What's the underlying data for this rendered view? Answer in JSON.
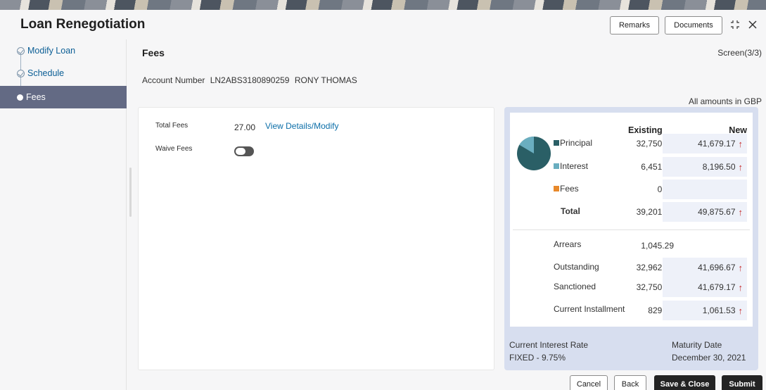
{
  "header": {
    "title": "Loan Renegotiation",
    "remarks_label": "Remarks",
    "documents_label": "Documents",
    "minimize_icon": "minimize-icon",
    "close_icon": "close-icon"
  },
  "sidebar": {
    "steps": [
      {
        "label": "Modify Loan",
        "state": "done"
      },
      {
        "label": "Schedule",
        "state": "done"
      },
      {
        "label": "Fees",
        "state": "active"
      }
    ]
  },
  "main": {
    "title": "Fees",
    "screen_indicator": "Screen(3/3)",
    "account_label": "Account Number",
    "account_number": "LN2ABS3180890259",
    "customer_name": "RONY THOMAS",
    "amounts_note": "All amounts in GBP"
  },
  "fees": {
    "total_fees_label": "Total Fees",
    "total_fees_value": "27.00",
    "view_link": "View Details/Modify",
    "waive_fees_label": "Waive Fees",
    "waive_fees_on": false
  },
  "summary": {
    "col_existing": "Existing",
    "col_new": "New",
    "colors": {
      "principal": "#2a5f66",
      "interest": "#6aaec0",
      "fees": "#e8892b",
      "increase_arrow": "#c62828"
    },
    "rows": [
      {
        "label": "Principal",
        "existing": "32,750.00",
        "new": "41,679.17"
      },
      {
        "label": "Interest",
        "existing": "6,451.03",
        "new": "8,196.50"
      },
      {
        "label": "Fees",
        "existing": "0.00",
        "new": ""
      },
      {
        "label": "Total",
        "existing": "39,201.03",
        "new": "49,875.67"
      },
      {
        "label": "Arrears",
        "existing": "1,045.29",
        "new": ""
      },
      {
        "label": "Outstanding",
        "existing": "32,962.40",
        "new": "41,696.67"
      },
      {
        "label": "Sanctioned",
        "existing": "32,750.00",
        "new": "41,679.17"
      },
      {
        "label": "Current Installment",
        "existing": "829.47",
        "new": "1,061.53"
      }
    ],
    "pie_fraction_principal": 0.835,
    "interest_rate_label": "Current Interest Rate",
    "interest_rate_value": "FIXED - 9.75%",
    "maturity_label": "Maturity Date",
    "maturity_value": "December 30, 2021"
  },
  "footer": {
    "cancel_label": "Cancel",
    "back_label": "Back",
    "save_close_label": "Save & Close",
    "submit_label": "Submit"
  }
}
